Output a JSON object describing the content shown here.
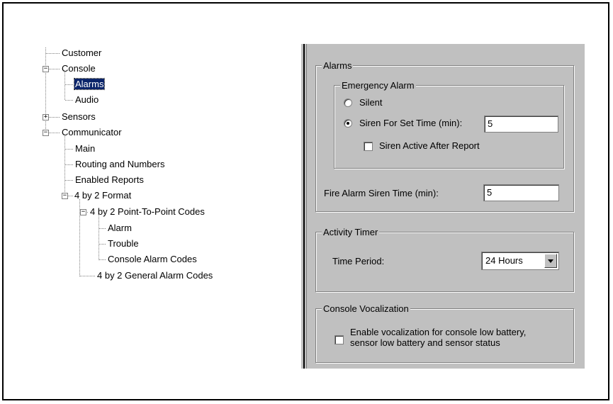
{
  "tree": {
    "customer": "Customer",
    "console": "Console",
    "alarms": "Alarms",
    "audio": "Audio",
    "sensors": "Sensors",
    "communicator": "Communicator",
    "main": "Main",
    "routing": "Routing and Numbers",
    "enabled_reports": "Enabled Reports",
    "format_4x2": "4 by 2 Format",
    "p2p_codes": "4 by 2 Point-To-Point Codes",
    "alarm": "Alarm",
    "trouble": "Trouble",
    "console_alarm_codes": "Console Alarm Codes",
    "general_codes": "4 by 2 General Alarm Codes",
    "expanded_symbol": "−",
    "collapsed_symbol": "+"
  },
  "alarms_group": {
    "title": "Alarms",
    "emergency": {
      "title": "Emergency Alarm",
      "silent_label": "Silent",
      "siren_label": "Siren For Set Time (min):",
      "siren_value": "5",
      "siren_active_label": "Siren Active After Report"
    },
    "fire_label": "Fire Alarm Siren Time (min):",
    "fire_value": "5"
  },
  "activity_group": {
    "title": "Activity Timer",
    "time_period_label": "Time Period:",
    "time_period_value": "24 Hours"
  },
  "vocalization_group": {
    "title": "Console Vocalization",
    "enable_label_line1": "Enable vocalization for console low battery,",
    "enable_label_line2": "sensor low battery and sensor status"
  }
}
